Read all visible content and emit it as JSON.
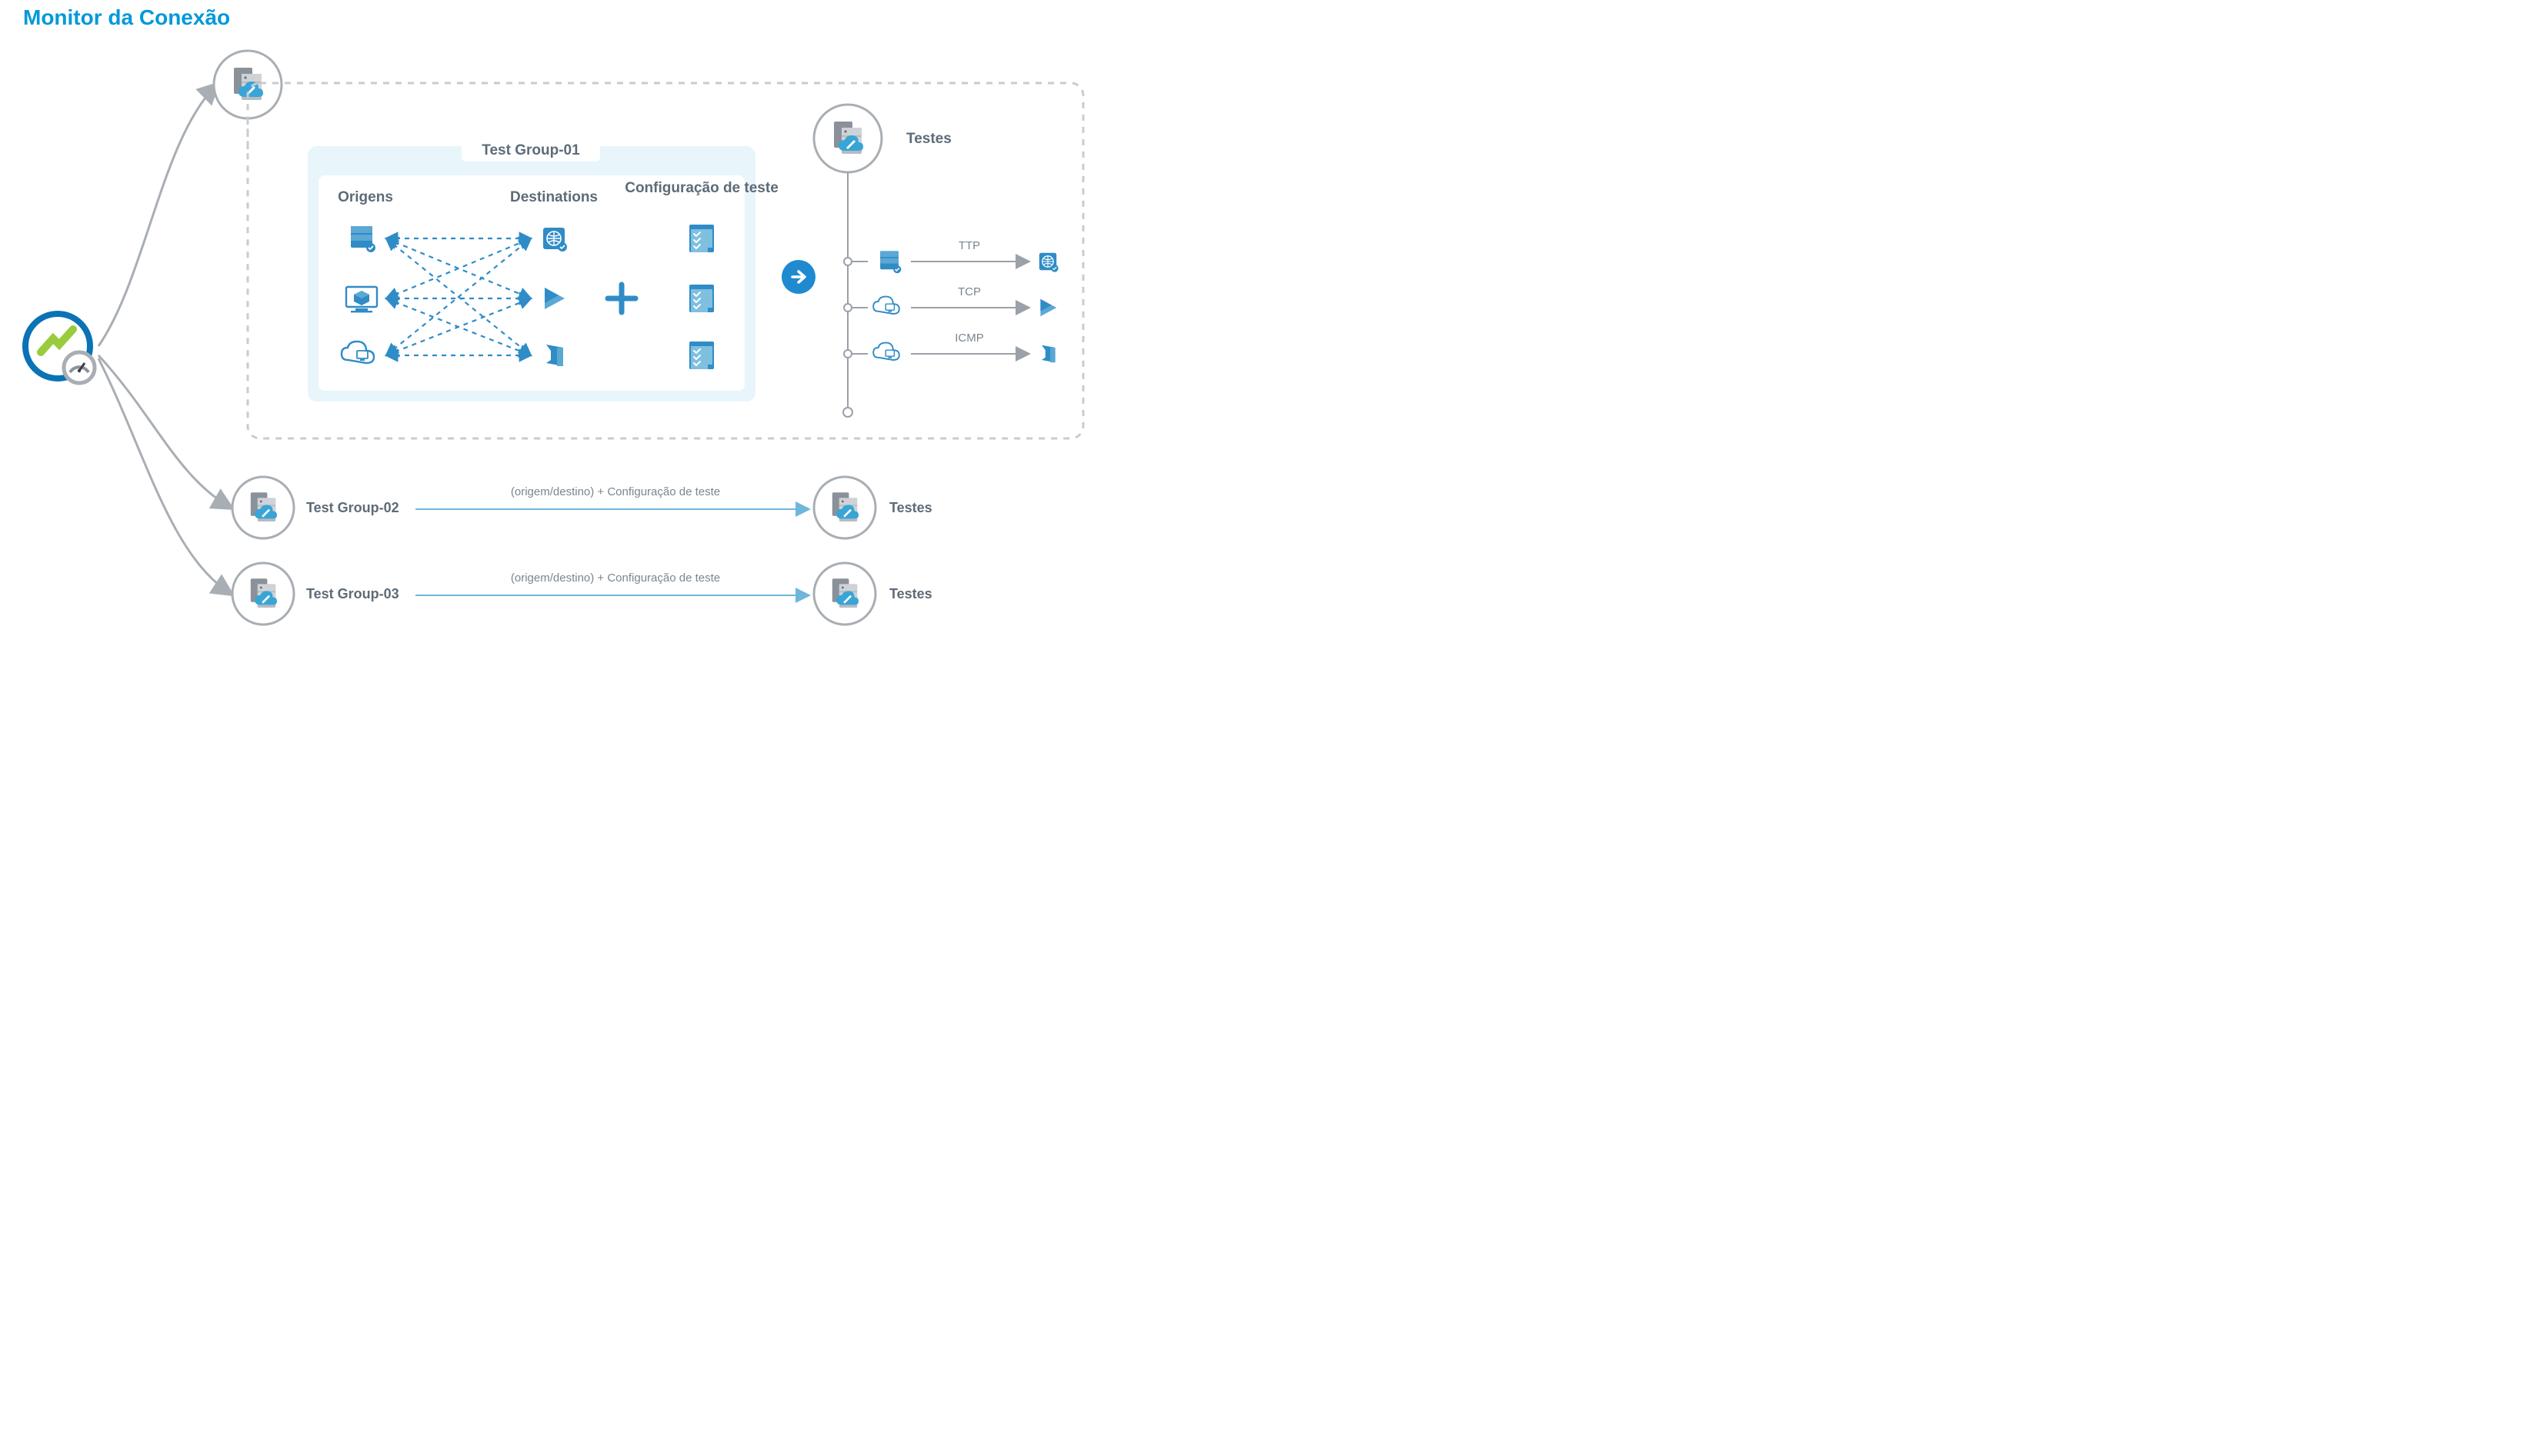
{
  "title": "Monitor da Conexão",
  "testGroup1": {
    "label": "Test Group-01",
    "cols": {
      "sources": "Origens",
      "destinations": "Destinations",
      "config": "Configuração de teste"
    }
  },
  "testsHeader": "Testes",
  "tests": [
    {
      "proto": "TTP"
    },
    {
      "proto": "TCP"
    },
    {
      "proto": "ICMP"
    }
  ],
  "rows": [
    {
      "group": "Test Group-02",
      "mid": "(origem/destino) + Configuração de teste",
      "right": "Testes"
    },
    {
      "group": "Test Group-03",
      "mid": "(origem/destino) + Configuração de teste",
      "right": "Testes"
    }
  ]
}
